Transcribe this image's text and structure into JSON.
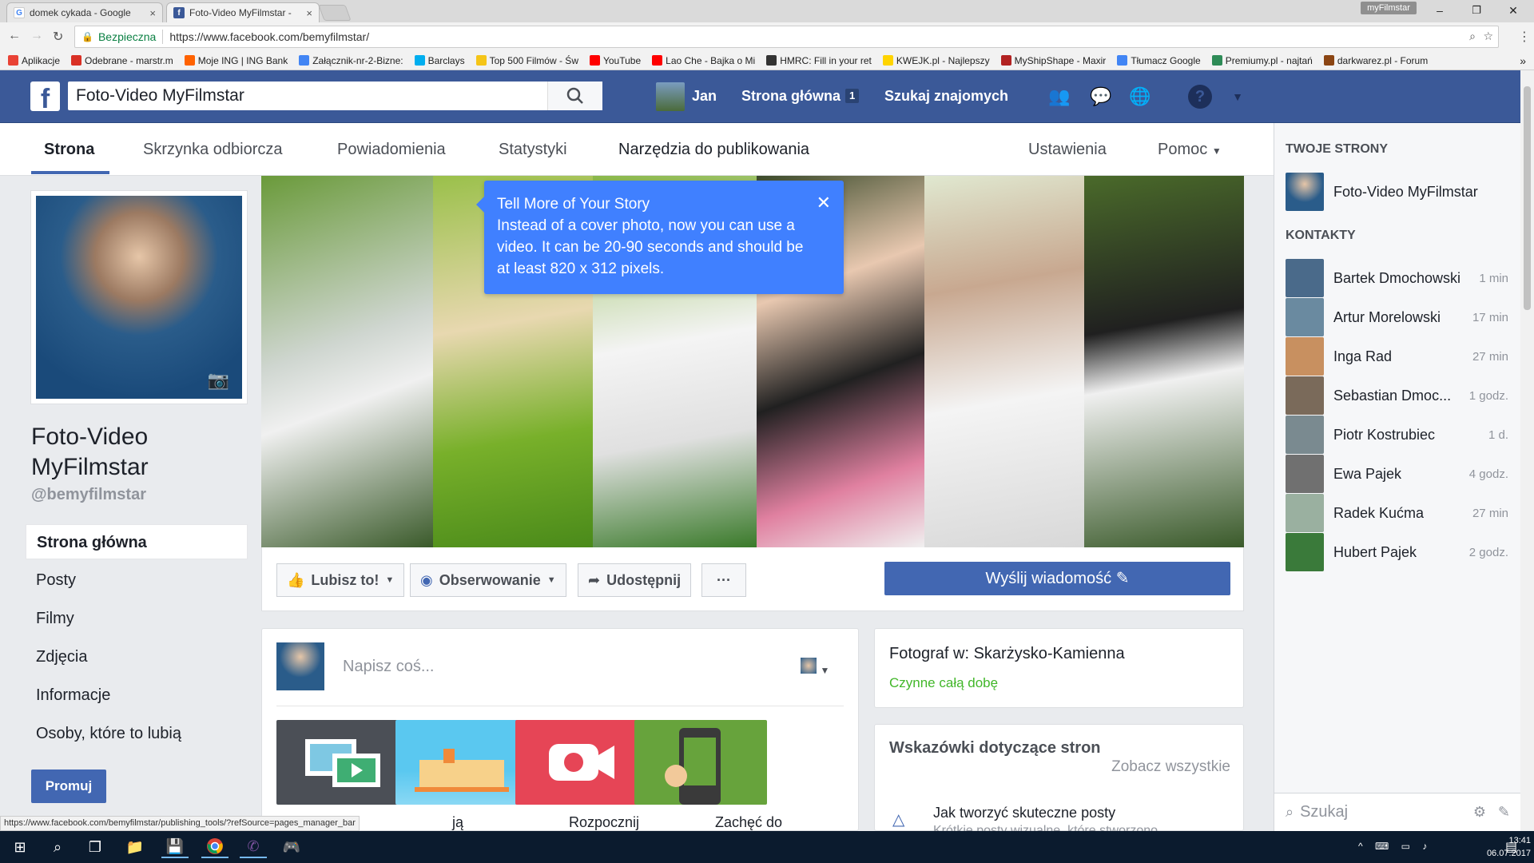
{
  "browser": {
    "tabs": [
      {
        "title": "domek cykada - Google",
        "close": "×"
      },
      {
        "title": "Foto-Video MyFilmstar -",
        "close": "×"
      }
    ],
    "user_badge": "myFilmstar",
    "window_controls": [
      "–",
      "❐",
      "✕"
    ],
    "secure_label": "Bezpieczna",
    "url": "https://www.facebook.com/bemyfilmstar/",
    "bookmarks": [
      {
        "label": "Aplikacje",
        "color": "#e94235"
      },
      {
        "label": "Odebrane - marstr.m",
        "color": "#d93025"
      },
      {
        "label": "Moje ING | ING Bank",
        "color": "#ff6200"
      },
      {
        "label": "Załącznik-nr-2-Bizne:",
        "color": "#4285f4"
      },
      {
        "label": "Barclays",
        "color": "#00aeef"
      },
      {
        "label": "Top 500 Filmów - Św",
        "color": "#f5c518"
      },
      {
        "label": "YouTube",
        "color": "#ff0000"
      },
      {
        "label": "Lao Che - Bajka o Mi",
        "color": "#ff0000"
      },
      {
        "label": "HMRC: Fill in your ret",
        "color": "#333333"
      },
      {
        "label": "KWEJK.pl - Najlepszy",
        "color": "#ffd400"
      },
      {
        "label": "MyShipShape - Maxir",
        "color": "#b22222"
      },
      {
        "label": "Tłumacz Google",
        "color": "#4285f4"
      },
      {
        "label": "Premiumy.pl - najtań",
        "color": "#2e8b57"
      },
      {
        "label": "darkwarez.pl - Forum",
        "color": "#8b4513"
      }
    ],
    "status_url": "https://www.facebook.com/bemyfilmstar/publishing_tools/?refSource=pages_manager_bar"
  },
  "fb_header": {
    "search_value": "Foto-Video MyFilmstar",
    "user": "Jan",
    "home": "Strona główna",
    "home_count": "1",
    "find_friends": "Szukaj znajomych"
  },
  "page_nav": {
    "tabs": [
      "Strona",
      "Skrzynka odbiorcza",
      "Powiadomienia",
      "Statystyki",
      "Narzędzia do publikowania"
    ],
    "settings": "Ustawienia",
    "help": "Pomoc"
  },
  "left": {
    "page_name": "Foto-Video MyFilmstar",
    "handle": "@bemyfilmstar",
    "links": [
      "Strona główna",
      "Posty",
      "Filmy",
      "Zdjęcia",
      "Informacje",
      "Osoby, które to lubią"
    ],
    "promote": "Promuj"
  },
  "cover_tip": {
    "title": "Tell More of Your Story",
    "body": "Instead of a cover photo, now you can use a video. It can be 20-90 seconds and should be at least 820 x 312 pixels.",
    "close": "✕"
  },
  "actions": {
    "like": "Lubisz to!",
    "follow": "Obserwowanie",
    "share": "Udostępnij",
    "more": "···",
    "message": "Wyślij wiadomość"
  },
  "composer": {
    "placeholder": "Napisz coś...",
    "tiles": [
      {
        "label": "ją",
        "color": "#4b4f56"
      },
      {
        "label": "",
        "color": "#5ac8f0"
      },
      {
        "label": "Rozpocznij",
        "color": "#e64556"
      },
      {
        "label": "Zachęć do",
        "color": "#67a33c"
      }
    ]
  },
  "info_card": {
    "category": "Fotograf w: Skarżysko-Kamienna",
    "hours": "Czynne całą dobę"
  },
  "tips_card": {
    "title": "Wskazówki dotyczące stron",
    "see_all": "Zobacz wszystkie",
    "item": "Jak tworzyć skuteczne posty",
    "item_sub": "Krótkie posty wizualne, które stworzono"
  },
  "right_sidebar": {
    "your_pages_heading": "TWOJE STRONY",
    "your_page": "Foto-Video MyFilmstar",
    "contacts_heading": "KONTAKTY",
    "contacts": [
      {
        "name": "Bartek Dmochowski",
        "time": "1 min",
        "color": "#4a6a8a"
      },
      {
        "name": "Artur Morelowski",
        "time": "17 min",
        "color": "#6a8aa0"
      },
      {
        "name": "Inga Rad",
        "time": "27 min",
        "color": "#c89060"
      },
      {
        "name": "Sebastian Dmoc...",
        "time": "1 godz.",
        "color": "#7a6a5a"
      },
      {
        "name": "Piotr Kostrubiec",
        "time": "1 d.",
        "color": "#7a8a90"
      },
      {
        "name": "Ewa Pajek",
        "time": "4 godz.",
        "color": "#707070"
      },
      {
        "name": "Radek Kućma",
        "time": "27 min",
        "color": "#9ab0a0"
      },
      {
        "name": "Hubert Pajek",
        "time": "2 godz.",
        "color": "#3a7a3a"
      }
    ],
    "search_placeholder": "Szukaj"
  },
  "taskbar": {
    "time": "13:41",
    "date": "06.07.2017"
  }
}
